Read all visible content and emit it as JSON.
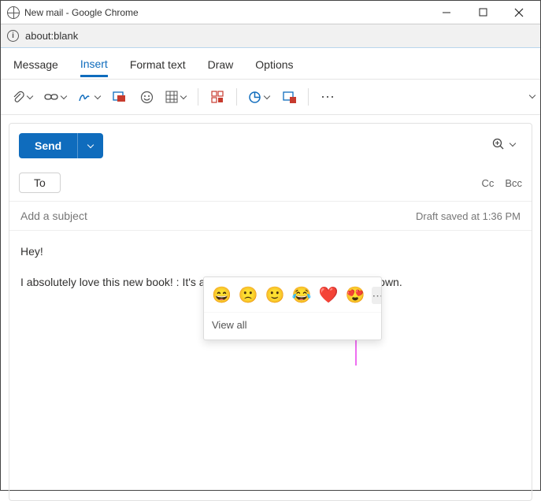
{
  "window": {
    "title": "New mail - Google Chrome",
    "url": "about:blank"
  },
  "tabs": {
    "message": "Message",
    "insert": "Insert",
    "format": "Format text",
    "draw": "Draw",
    "options": "Options"
  },
  "toolbar": {
    "attach_name": "attach-file",
    "link_name": "link",
    "signature_name": "signature",
    "pictures_name": "pictures",
    "emoji_name": "emoji",
    "table_name": "table",
    "business_name": "business",
    "loop_name": "loop-component",
    "poll_name": "poll",
    "more": "⋯"
  },
  "compose": {
    "send": "Send",
    "to": "To",
    "cc": "Cc",
    "bcc": "Bcc",
    "subject_placeholder": "Add a subject",
    "draft_saved": "Draft saved at 1:36 PM"
  },
  "body": {
    "line1": "Hey!",
    "line2": "I absolutely love this new book! : It's a captivating read, and I can't put it down."
  },
  "emoji_popup": {
    "e1": "😄",
    "e2": "🙁",
    "e3": "🙂",
    "e4": "😂",
    "e5": "❤️",
    "e6": "😍",
    "more": "⋯",
    "view_all": "View all"
  }
}
